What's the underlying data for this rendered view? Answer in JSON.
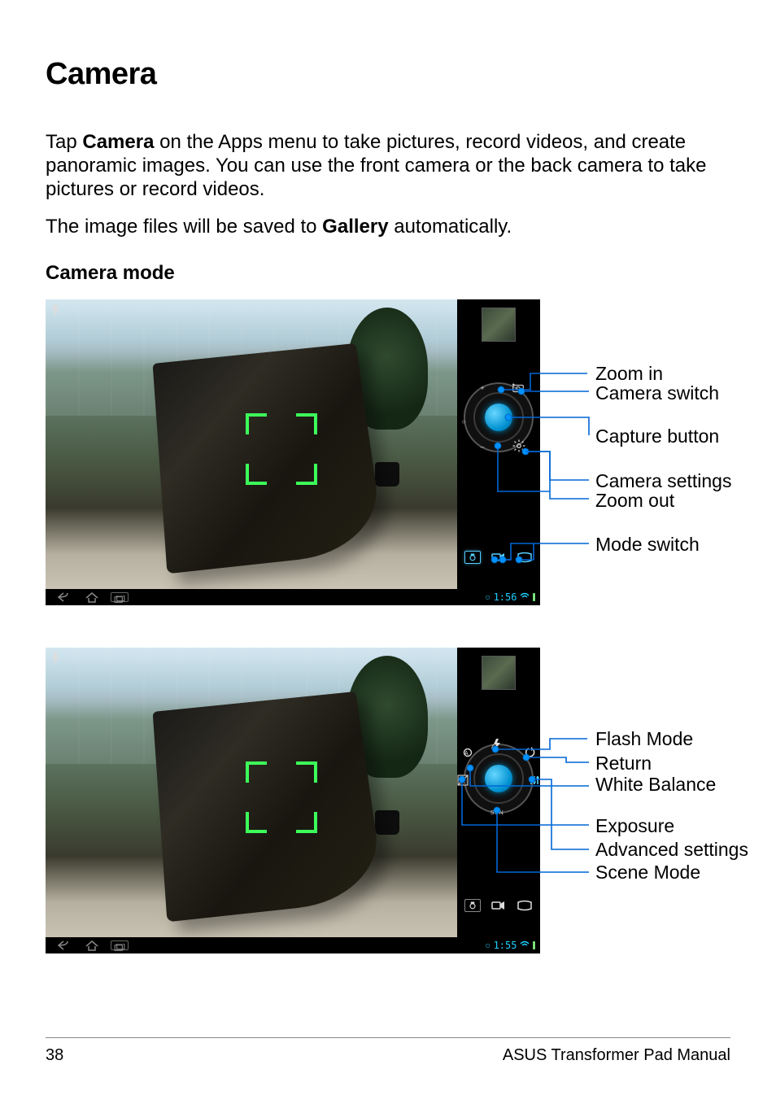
{
  "title": "Camera",
  "para1_pre": "Tap ",
  "para1_bold": "Camera",
  "para1_post": " on the Apps menu to take pictures, record videos, and create panoramic images. You can use the front camera or the back camera to take pictures or record videos.",
  "para2_pre": "The image files will be saved to ",
  "para2_bold": "Gallery",
  "para2_post": " automatically.",
  "section": "Camera mode",
  "fig1": {
    "time": "1:56",
    "labels": {
      "zoom_in": "Zoom in",
      "camera_switch": "Camera switch",
      "capture": "Capture button",
      "settings": "Camera settings",
      "zoom_out": "Zoom out",
      "mode_switch": "Mode switch"
    }
  },
  "fig2": {
    "time": "1:55",
    "dial": {
      "scn": "SCN"
    },
    "labels": {
      "flash": "Flash Mode",
      "return": "Return",
      "wb": "White Balance",
      "exposure": "Exposure",
      "adv": "Advanced settings",
      "scene": "Scene Mode"
    }
  },
  "footer": {
    "page": "38",
    "book": "ASUS Transformer Pad Manual"
  }
}
